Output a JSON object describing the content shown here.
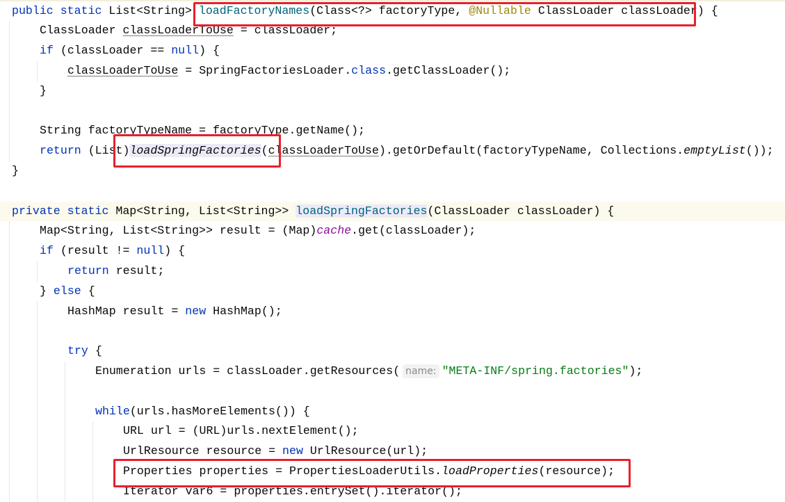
{
  "editor": {
    "colors": {
      "keyword": "#0033b3",
      "method_decl": "#00627a",
      "annotation": "#9e880d",
      "string": "#067d17",
      "static_field": "#871094",
      "highlight_box": "#e8202a",
      "current_line": "#fcfaed"
    },
    "current_line_index": 10,
    "lines": [
      {
        "indent": 0,
        "tokens": [
          {
            "t": "public static ",
            "c": "kw"
          },
          {
            "t": "List<String> "
          },
          {
            "t": "loadFactoryNames",
            "c": "fn"
          },
          {
            "t": "(Class<?> factoryType, "
          },
          {
            "t": "@Nullable",
            "c": "ann"
          },
          {
            "t": " ClassLoader classLoader) {"
          }
        ]
      },
      {
        "indent": 1,
        "tokens": [
          {
            "t": "ClassLoader "
          },
          {
            "t": "classLoaderToUse",
            "c": "ul"
          },
          {
            "t": " = classLoader;"
          }
        ]
      },
      {
        "indent": 1,
        "tokens": [
          {
            "t": "if",
            "c": "kw"
          },
          {
            "t": " (classLoader == "
          },
          {
            "t": "null",
            "c": "kw"
          },
          {
            "t": ") {"
          }
        ]
      },
      {
        "indent": 2,
        "tokens": [
          {
            "t": "classLoaderToUse",
            "c": "ul"
          },
          {
            "t": " = SpringFactoriesLoader."
          },
          {
            "t": "class",
            "c": "kw"
          },
          {
            "t": ".getClassLoader();"
          }
        ]
      },
      {
        "indent": 1,
        "tokens": [
          {
            "t": "}"
          }
        ]
      },
      {
        "indent": 0,
        "tokens": []
      },
      {
        "indent": 1,
        "tokens": [
          {
            "t": "String factoryTypeName = factoryType.getName();"
          }
        ]
      },
      {
        "indent": 1,
        "tokens": [
          {
            "t": "return",
            "c": "kw"
          },
          {
            "t": " (List)"
          },
          {
            "t": "loadSpringFactories",
            "c": "it hl"
          },
          {
            "t": "("
          },
          {
            "t": "classLoaderToUse",
            "c": "ul"
          },
          {
            "t": ").getOrDefault(factoryTypeName, Collections."
          },
          {
            "t": "emptyList",
            "c": "it"
          },
          {
            "t": "());"
          }
        ]
      },
      {
        "indent": 0,
        "tokens": [
          {
            "t": "}"
          }
        ]
      },
      {
        "indent": 0,
        "tokens": []
      },
      {
        "indent": 0,
        "tokens": [
          {
            "t": "private static ",
            "c": "kw"
          },
          {
            "t": "Map<String, List<String>> "
          },
          {
            "t": "loadSpringFactories",
            "c": "fn hl"
          },
          {
            "t": "(ClassLoader classLoader) {"
          }
        ]
      },
      {
        "indent": 1,
        "tokens": [
          {
            "t": "Map<String, List<String>> result = (Map)"
          },
          {
            "t": "cache",
            "c": "static"
          },
          {
            "t": ".get(classLoader);"
          }
        ]
      },
      {
        "indent": 1,
        "tokens": [
          {
            "t": "if",
            "c": "kw"
          },
          {
            "t": " (result != "
          },
          {
            "t": "null",
            "c": "kw"
          },
          {
            "t": ") {"
          }
        ]
      },
      {
        "indent": 2,
        "tokens": [
          {
            "t": "return",
            "c": "kw"
          },
          {
            "t": " result;"
          }
        ]
      },
      {
        "indent": 1,
        "tokens": [
          {
            "t": "} "
          },
          {
            "t": "else",
            "c": "kw"
          },
          {
            "t": " {"
          }
        ]
      },
      {
        "indent": 2,
        "tokens": [
          {
            "t": "HashMap result = "
          },
          {
            "t": "new",
            "c": "kw"
          },
          {
            "t": " HashMap();"
          }
        ]
      },
      {
        "indent": 0,
        "tokens": []
      },
      {
        "indent": 2,
        "tokens": [
          {
            "t": "try",
            "c": "kw"
          },
          {
            "t": " {"
          }
        ]
      },
      {
        "indent": 3,
        "tokens": [
          {
            "t": "Enumeration urls = classLoader.getResources("
          },
          {
            "t": "name:",
            "c": "hint"
          },
          {
            "t": "\"META-INF/spring.factories\"",
            "c": "str"
          },
          {
            "t": ");"
          }
        ]
      },
      {
        "indent": 0,
        "tokens": []
      },
      {
        "indent": 3,
        "tokens": [
          {
            "t": "while",
            "c": "kw"
          },
          {
            "t": "(urls.hasMoreElements()) {"
          }
        ]
      },
      {
        "indent": 4,
        "tokens": [
          {
            "t": "URL url = (URL)urls.nextElement();"
          }
        ]
      },
      {
        "indent": 4,
        "tokens": [
          {
            "t": "UrlResource resource = "
          },
          {
            "t": "new",
            "c": "kw"
          },
          {
            "t": " UrlResource(url);"
          }
        ]
      },
      {
        "indent": 4,
        "tokens": [
          {
            "t": "Properties properties = PropertiesLoaderUtils."
          },
          {
            "t": "loadProperties",
            "c": "it"
          },
          {
            "t": "(resource);"
          }
        ]
      },
      {
        "indent": 4,
        "tokens": [
          {
            "t": "Iterator var6 = properties.entrySet().iterator();"
          }
        ]
      }
    ]
  }
}
